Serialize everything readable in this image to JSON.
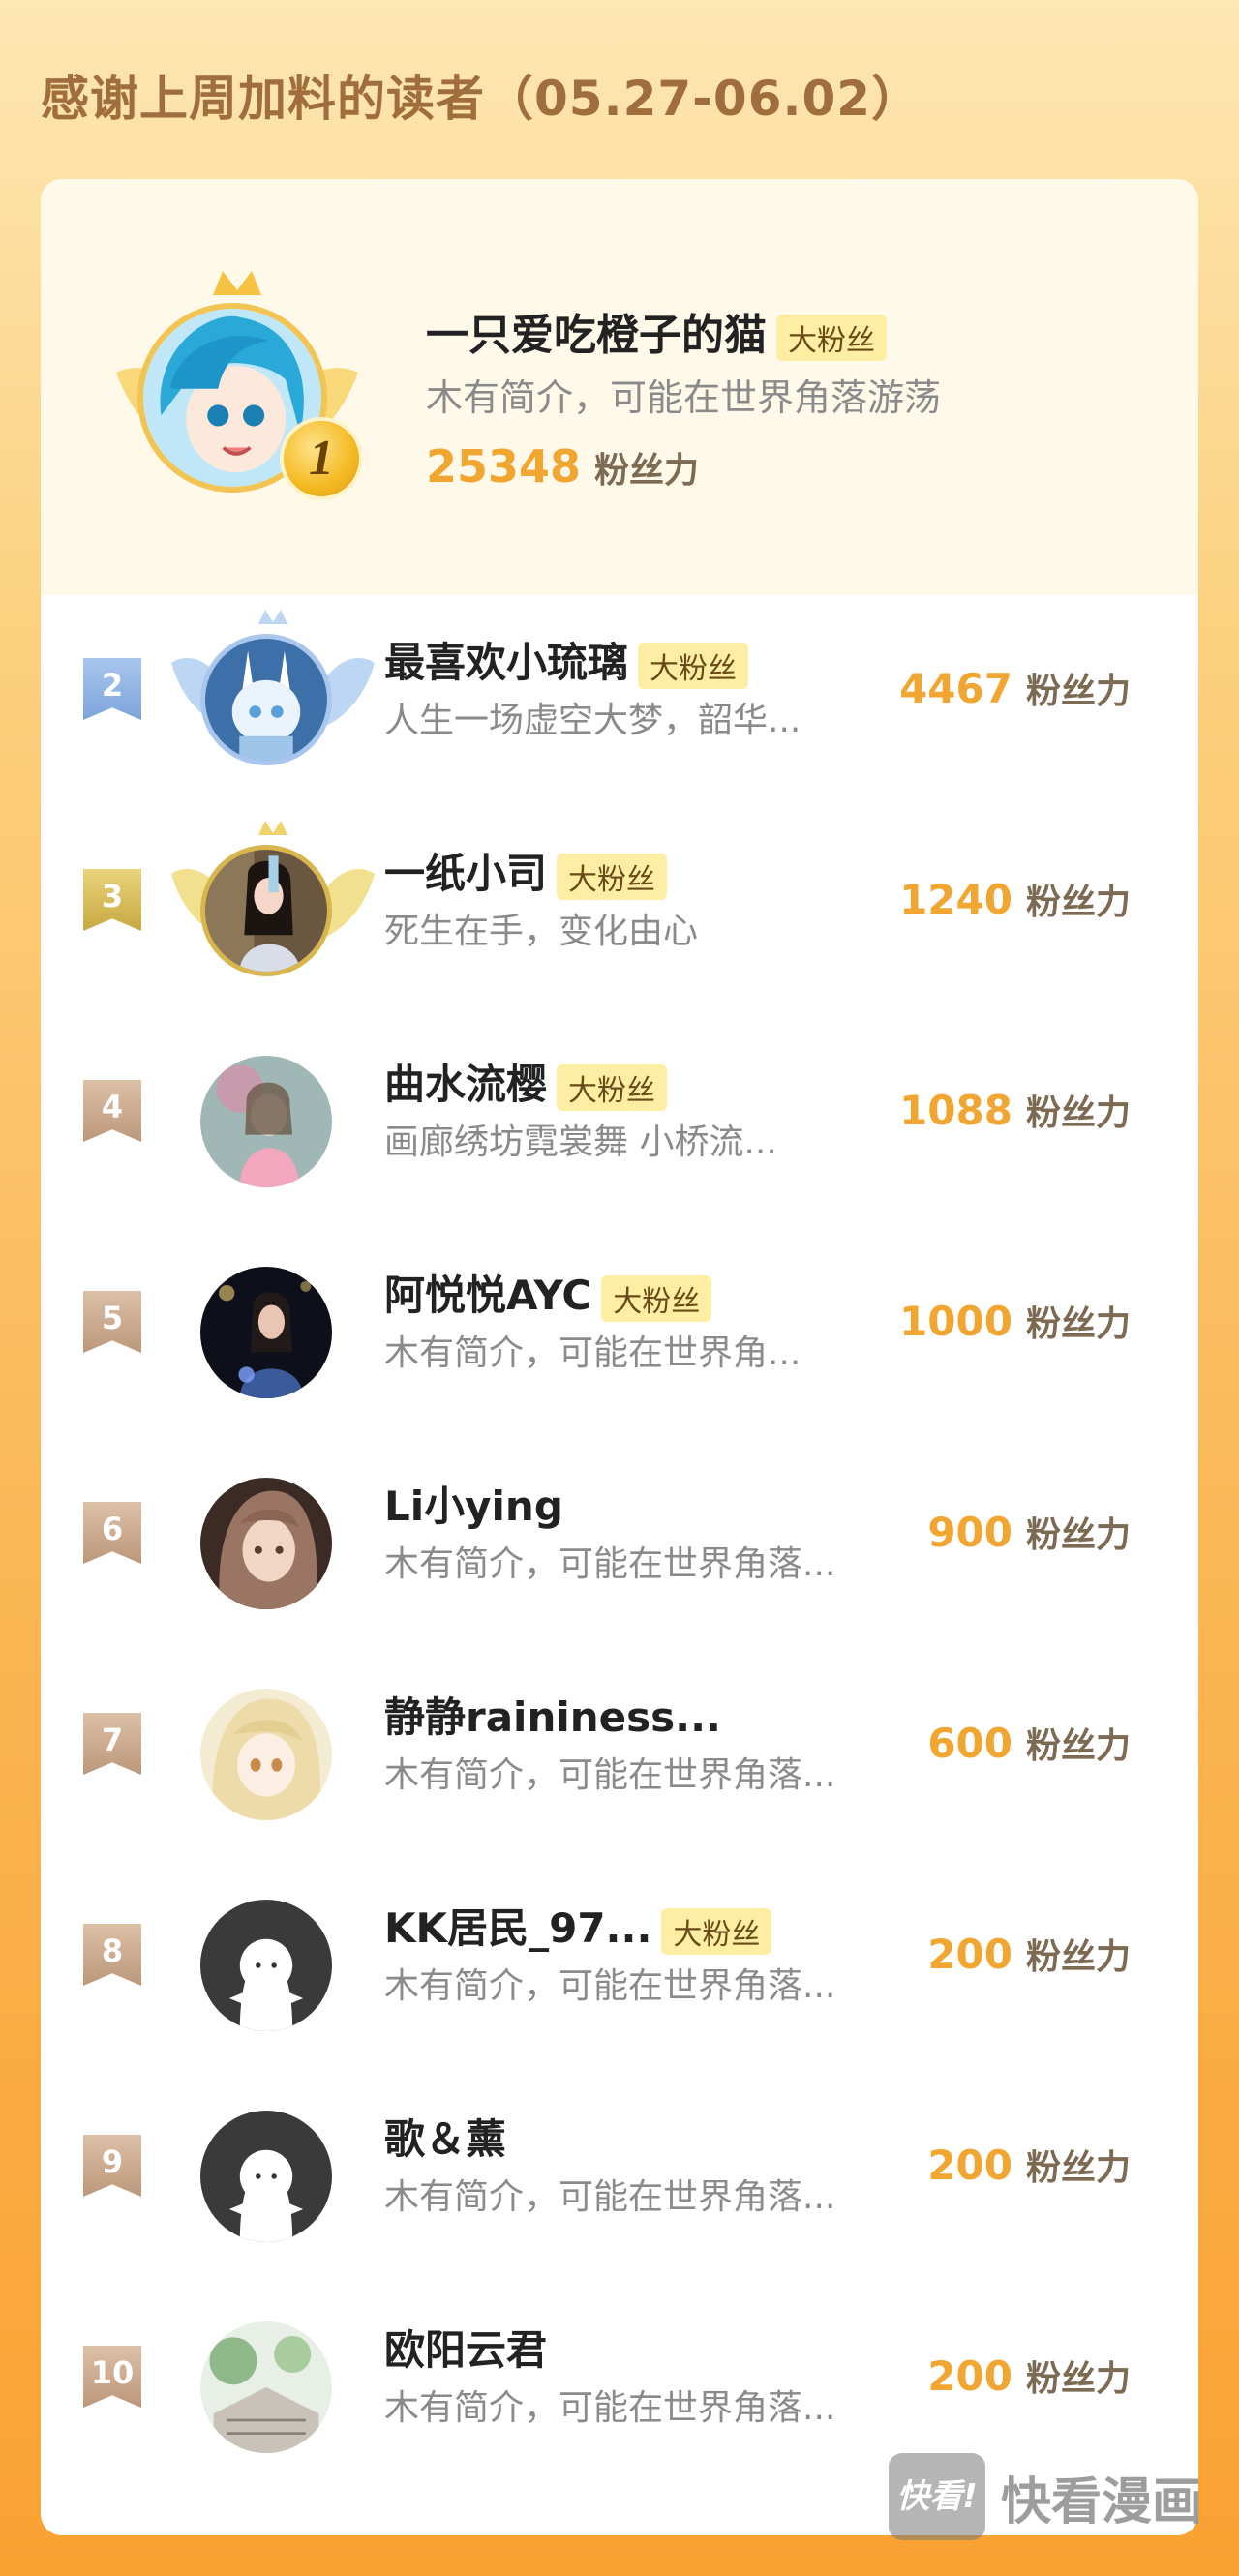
{
  "title": "感谢上周加料的读者（05.27-06.02）",
  "top_user": {
    "rank": "1",
    "name": "一只爱吃橙子的猫",
    "badge": "大粉丝",
    "bio": "木有简介，可能在世界角落游荡",
    "score": "25348",
    "score_unit": "粉丝力"
  },
  "list": [
    {
      "rank": "2",
      "name": "最喜欢小琉璃",
      "badge": "大粉丝",
      "bio": "人生一场虚空大梦，韶华...",
      "score": "4467",
      "score_unit": "粉丝力"
    },
    {
      "rank": "3",
      "name": "一纸小司",
      "badge": "大粉丝",
      "bio": "死生在手，变化由心",
      "score": "1240",
      "score_unit": "粉丝力"
    },
    {
      "rank": "4",
      "name": "曲水流樱",
      "badge": "大粉丝",
      "bio": "画廊绣坊霓裳舞 小桥流...",
      "score": "1088",
      "score_unit": "粉丝力"
    },
    {
      "rank": "5",
      "name": "阿悦悦AYC",
      "badge": "大粉丝",
      "bio": "木有简介，可能在世界角...",
      "score": "1000",
      "score_unit": "粉丝力"
    },
    {
      "rank": "6",
      "name": "Li小ying",
      "badge": "",
      "bio": "木有简介，可能在世界角落...",
      "score": "900",
      "score_unit": "粉丝力"
    },
    {
      "rank": "7",
      "name": "静静raininess...",
      "badge": "",
      "bio": "木有简介，可能在世界角落...",
      "score": "600",
      "score_unit": "粉丝力"
    },
    {
      "rank": "8",
      "name": "KK居民_97...",
      "badge": "大粉丝",
      "bio": "木有简介，可能在世界角落...",
      "score": "200",
      "score_unit": "粉丝力"
    },
    {
      "rank": "9",
      "name": "歌＆薰",
      "badge": "",
      "bio": "木有简介，可能在世界角落...",
      "score": "200",
      "score_unit": "粉丝力"
    },
    {
      "rank": "10",
      "name": "欧阳云君",
      "badge": "",
      "bio": "木有简介，可能在世界角落...",
      "score": "200",
      "score_unit": "粉丝力"
    }
  ],
  "watermark": {
    "logo": "快看!",
    "text": "快看漫画"
  },
  "colors": {
    "accent": "#f0a630",
    "badge_bg": "#fdeea4",
    "title": "#a06e3c"
  }
}
